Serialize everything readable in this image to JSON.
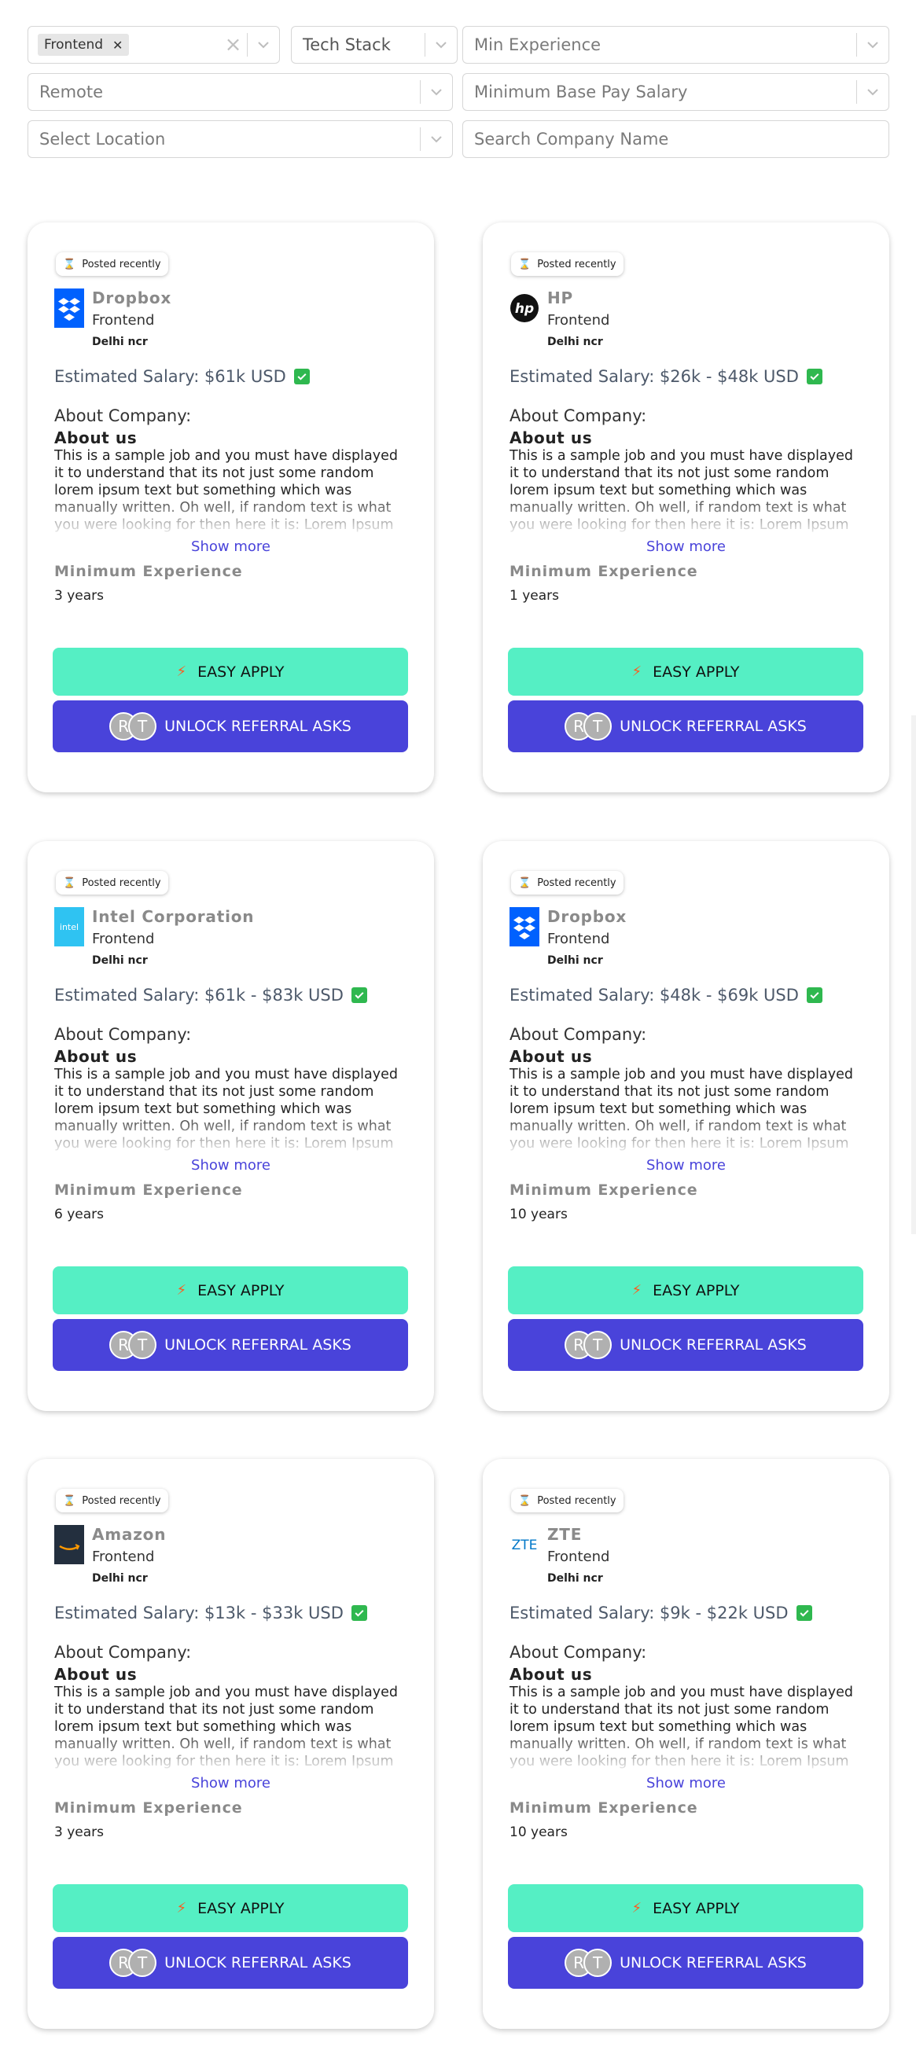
{
  "filters": {
    "role_chip": "Frontend",
    "tech_stack": "Tech Stack",
    "min_experience": "Min Experience",
    "remote": "Remote",
    "min_base_pay": "Minimum Base Pay Salary",
    "location": "Select Location",
    "company_search_placeholder": "Search Company Name"
  },
  "common": {
    "posted": "Posted recently",
    "about_company": "About Company:",
    "about_us": "About us",
    "description": "This is a sample job and you must have displayed it to understand that its not just some random lorem ipsum text but something which was manually written. Oh well, if random text is what you were looking for then here it is: Lorem Ipsum is simply dummy text of the printing and typesetting industry. ...",
    "show_more": "Show more",
    "min_exp_label": "Minimum Experience",
    "easy_apply": "EASY APPLY",
    "referral": "UNLOCK REFERRAL ASKS",
    "avatar_1": "R",
    "avatar_2": "T"
  },
  "jobs": [
    {
      "company": "Dropbox",
      "role": "Frontend",
      "location": "Delhi ncr",
      "salary": "Estimated Salary: $61k USD",
      "experience": "3 years",
      "logo": "dropbox-logo-icon"
    },
    {
      "company": "HP",
      "role": "Frontend",
      "location": "Delhi ncr",
      "salary": "Estimated Salary: $26k - $48k USD",
      "experience": "1 years",
      "logo": "hp-logo-icon"
    },
    {
      "company": "Intel Corporation",
      "role": "Frontend",
      "location": "Delhi ncr",
      "salary": "Estimated Salary: $61k - $83k USD",
      "experience": "6 years",
      "logo": "intel-logo-icon"
    },
    {
      "company": "Dropbox",
      "role": "Frontend",
      "location": "Delhi ncr",
      "salary": "Estimated Salary: $48k - $69k USD",
      "experience": "10 years",
      "logo": "dropbox-logo-icon"
    },
    {
      "company": "Amazon",
      "role": "Frontend",
      "location": "Delhi ncr",
      "salary": "Estimated Salary: $13k - $33k USD",
      "experience": "3 years",
      "logo": "amazon-logo-icon"
    },
    {
      "company": "ZTE",
      "role": "Frontend",
      "location": "Delhi ncr",
      "salary": "Estimated Salary: $9k - $22k USD",
      "experience": "10 years",
      "logo": "zte-logo-icon"
    }
  ],
  "colors": {
    "apply": "#55efc4",
    "referral": "#4943da",
    "check": "#2fb84f"
  }
}
